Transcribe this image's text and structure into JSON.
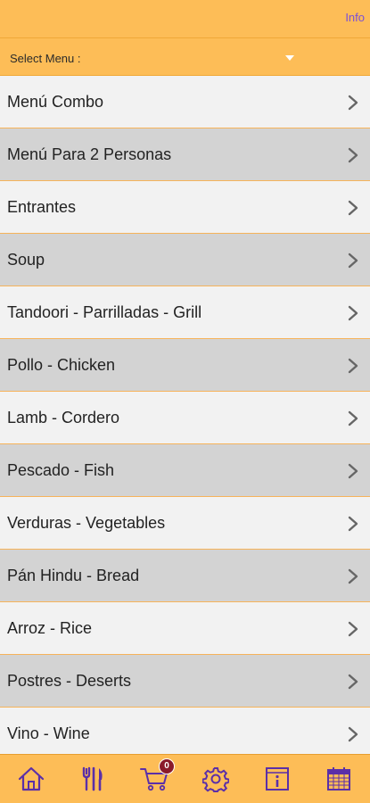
{
  "header": {
    "info_label": "Info"
  },
  "select_menu": {
    "label": "Select Menu :"
  },
  "menu": {
    "items": [
      {
        "label": "Menú Combo"
      },
      {
        "label": "Menú Para 2 Personas"
      },
      {
        "label": "Entrantes"
      },
      {
        "label": "Soup"
      },
      {
        "label": "Tandoori - Parrilladas - Grill"
      },
      {
        "label": "Pollo - Chicken"
      },
      {
        "label": "Lamb - Cordero"
      },
      {
        "label": "Pescado - Fish"
      },
      {
        "label": "Verduras - Vegetables"
      },
      {
        "label": "Pán Hindu - Bread"
      },
      {
        "label": "Arroz - Rice"
      },
      {
        "label": "Postres - Deserts"
      },
      {
        "label": "Vino - Wine"
      }
    ]
  },
  "tabbar": {
    "cart_count": "0",
    "tabs": [
      {
        "icon": "home-icon"
      },
      {
        "icon": "fork-knife-icon"
      },
      {
        "icon": "cart-icon"
      },
      {
        "icon": "gear-icon"
      },
      {
        "icon": "info-icon"
      },
      {
        "icon": "calendar-icon"
      }
    ]
  },
  "colors": {
    "header_bg": "#fdbd57",
    "row_light": "#f2f2f2",
    "row_dark": "#d3d3d3",
    "divider": "#f6b35a",
    "icon_purple": "#5b2fa8",
    "info_link": "#7a4fd8",
    "badge": "#8a1a2a"
  }
}
